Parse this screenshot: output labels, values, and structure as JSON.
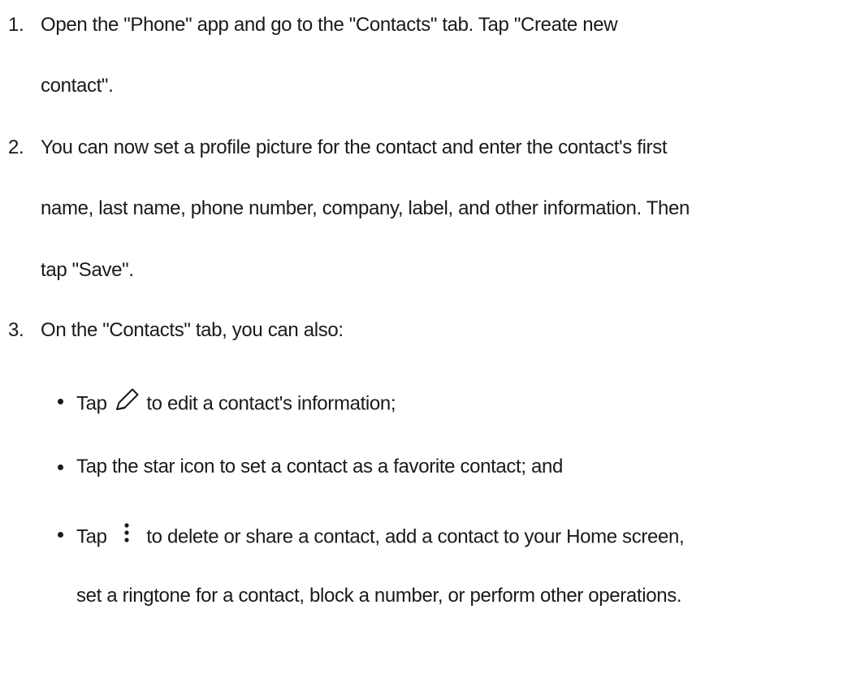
{
  "steps": [
    {
      "number": "1.",
      "lines": [
        "Open the \"Phone\" app and go to the \"Contacts\" tab. Tap \"Create new",
        "contact\"."
      ]
    },
    {
      "number": "2.",
      "lines": [
        "You can now set a profile picture for the contact and enter the contact's first",
        "name, last name, phone number, company, label, and other information. Then",
        "tap \"Save\"."
      ]
    },
    {
      "number": "3.",
      "lines": [
        "On the \"Contacts\" tab, you can also:"
      ]
    }
  ],
  "bullets": [
    {
      "before": "Tap",
      "icon": "pencil-icon",
      "after": "to edit a contact's information;"
    },
    {
      "text": "Tap the star icon to set a contact as a favorite contact; and"
    },
    {
      "before": "Tap",
      "icon": "more-vertical-icon",
      "after": "to delete or share a contact, add a contact to your Home screen,",
      "continuation": "set a ringtone for a contact, block a number, or perform other operations."
    }
  ]
}
